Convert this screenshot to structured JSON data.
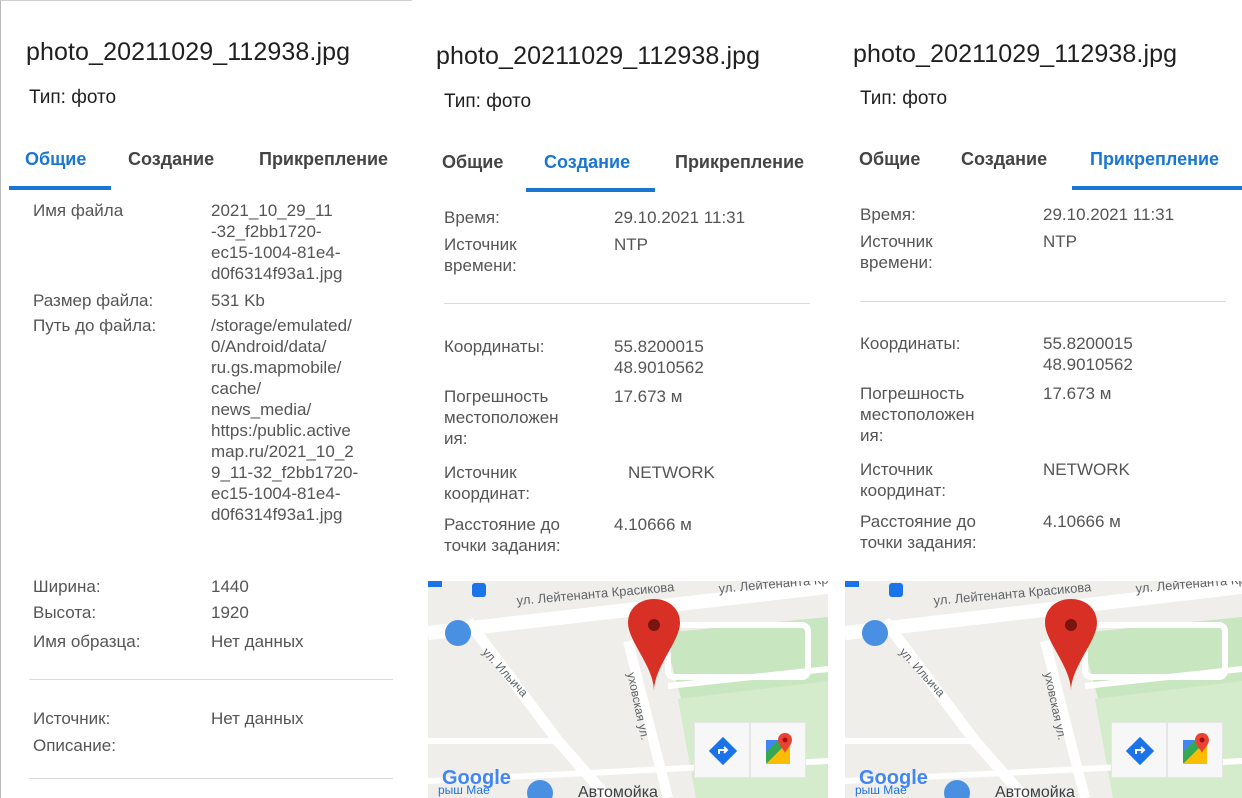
{
  "panels": [
    {
      "title": "photo_20211029_112938.jpg",
      "type_label": "Тип: фото",
      "tabs": [
        "Общие",
        "Создание",
        "Прикрепление"
      ],
      "active_tab": 0,
      "rows": [
        {
          "label": "Имя файла",
          "value": "2021_10_29_11\n-32_f2bb1720-\nec15-1004-81e4-\nd0f6314f93a1.jpg"
        },
        {
          "label": "Размер файла:",
          "value": "531 Kb"
        },
        {
          "label": "Путь до файла:",
          "value": "/storage/emulated/\n0/Android/data/\nru.gs.mapmobile/\ncache/\nnews_media/\nhttps:/public.active\nmap.ru/2021_10_2\n9_11-32_f2bb1720-\nec15-1004-81e4-\nd0f6314f93a1.jpg"
        },
        {
          "label": "Ширина:",
          "value": "1440"
        },
        {
          "label": "Высота:",
          "value": "1920"
        },
        {
          "label": "Имя образца:",
          "value": "Нет данных"
        },
        {
          "label": "Источник:",
          "value": "Нет данных"
        },
        {
          "label": "Описание:",
          "value": ""
        }
      ]
    },
    {
      "title": "photo_20211029_112938.jpg",
      "type_label": "Тип: фото",
      "tabs": [
        "Общие",
        "Создание",
        "Прикрепление"
      ],
      "active_tab": 1,
      "rows": [
        {
          "label": "Время:",
          "value": "29.10.2021 11:31"
        },
        {
          "label": "Источник\nвремени:",
          "value": "NTP"
        },
        {
          "label": "Координаты:",
          "value": "55.8200015\n48.9010562"
        },
        {
          "label": "Погрешность\nместоположен\nия:",
          "value": "17.673 м"
        },
        {
          "label": "Источник\nкоординат:",
          "value": "NETWORK"
        },
        {
          "label": "Расстояние до\nточки задания:",
          "value": "4.10666 м"
        }
      ],
      "map": {
        "street_1": "ул. Лейтенанта Красикова",
        "street_2": "ул. Лейтенанта Кра",
        "street_3": "ул. Ильича",
        "street_4": "уховская ул.",
        "poi_1": "Автомойка",
        "poi_2": "рыш Мае",
        "google": "Google"
      }
    },
    {
      "title": "photo_20211029_112938.jpg",
      "type_label": "Тип: фото",
      "tabs": [
        "Общие",
        "Создание",
        "Прикрепление"
      ],
      "active_tab": 2,
      "rows": [
        {
          "label": "Время:",
          "value": "29.10.2021 11:31"
        },
        {
          "label": "Источник\nвремени:",
          "value": "NTP"
        },
        {
          "label": "Координаты:",
          "value": "55.8200015\n48.9010562"
        },
        {
          "label": "Погрешность\nместоположен\nия:",
          "value": "17.673 м"
        },
        {
          "label": "Источник\nкоординат:",
          "value": "NETWORK"
        },
        {
          "label": "Расстояние до\nточки задания:",
          "value": "4.10666 м"
        }
      ],
      "map": {
        "street_1": "ул. Лейтенанта Красикова",
        "street_2": "ул. Лейтенанта Кра",
        "street_3": "ул. Ильича",
        "street_4": "уховская ул.",
        "poi_1": "Автомойка",
        "poi_2": "рыш Мае",
        "google": "Google"
      }
    }
  ],
  "icons": {
    "directions": "directions-icon",
    "maps_app": "google-maps-icon",
    "marker": "map-marker-icon",
    "bus": "bus-stop-icon",
    "shopping": "shopping-bag-icon"
  },
  "colors": {
    "accent": "#1976d2",
    "marker": "#d93025",
    "park": "#c8e6c0"
  }
}
